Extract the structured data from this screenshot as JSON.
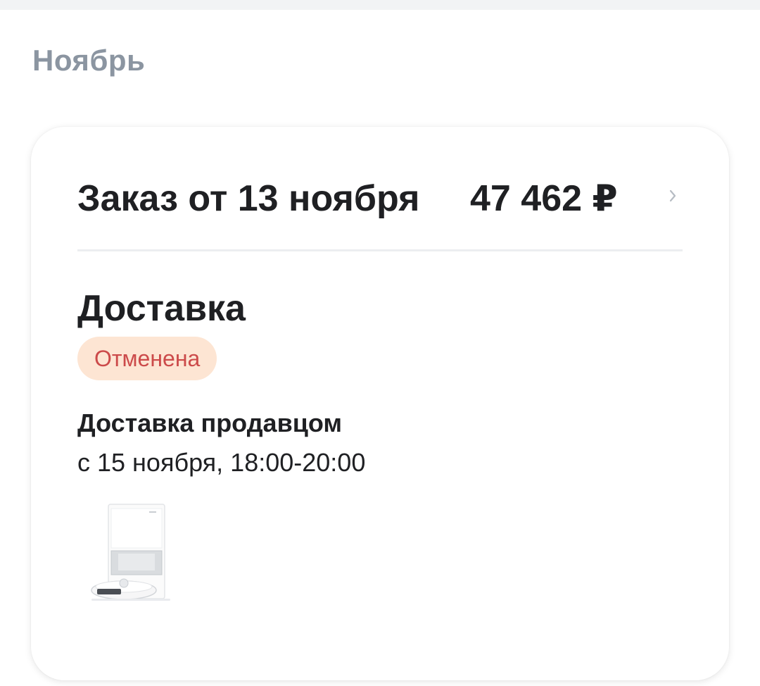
{
  "month": {
    "title": "Ноябрь"
  },
  "order": {
    "title": "Заказ от 13 ноября",
    "amount": "47 462 ₽",
    "delivery": {
      "title": "Доставка",
      "status": "Отменена",
      "method": "Доставка продавцом",
      "time": "с 15 ноября, 18:00-20:00"
    },
    "product_icon": "robot-vacuum-station-icon"
  },
  "colors": {
    "month_title": "#8b95a1",
    "text_primary": "#1f2023",
    "status_bg": "#fde5d3",
    "status_text": "#cc4a4a",
    "divider": "#eceef0"
  }
}
